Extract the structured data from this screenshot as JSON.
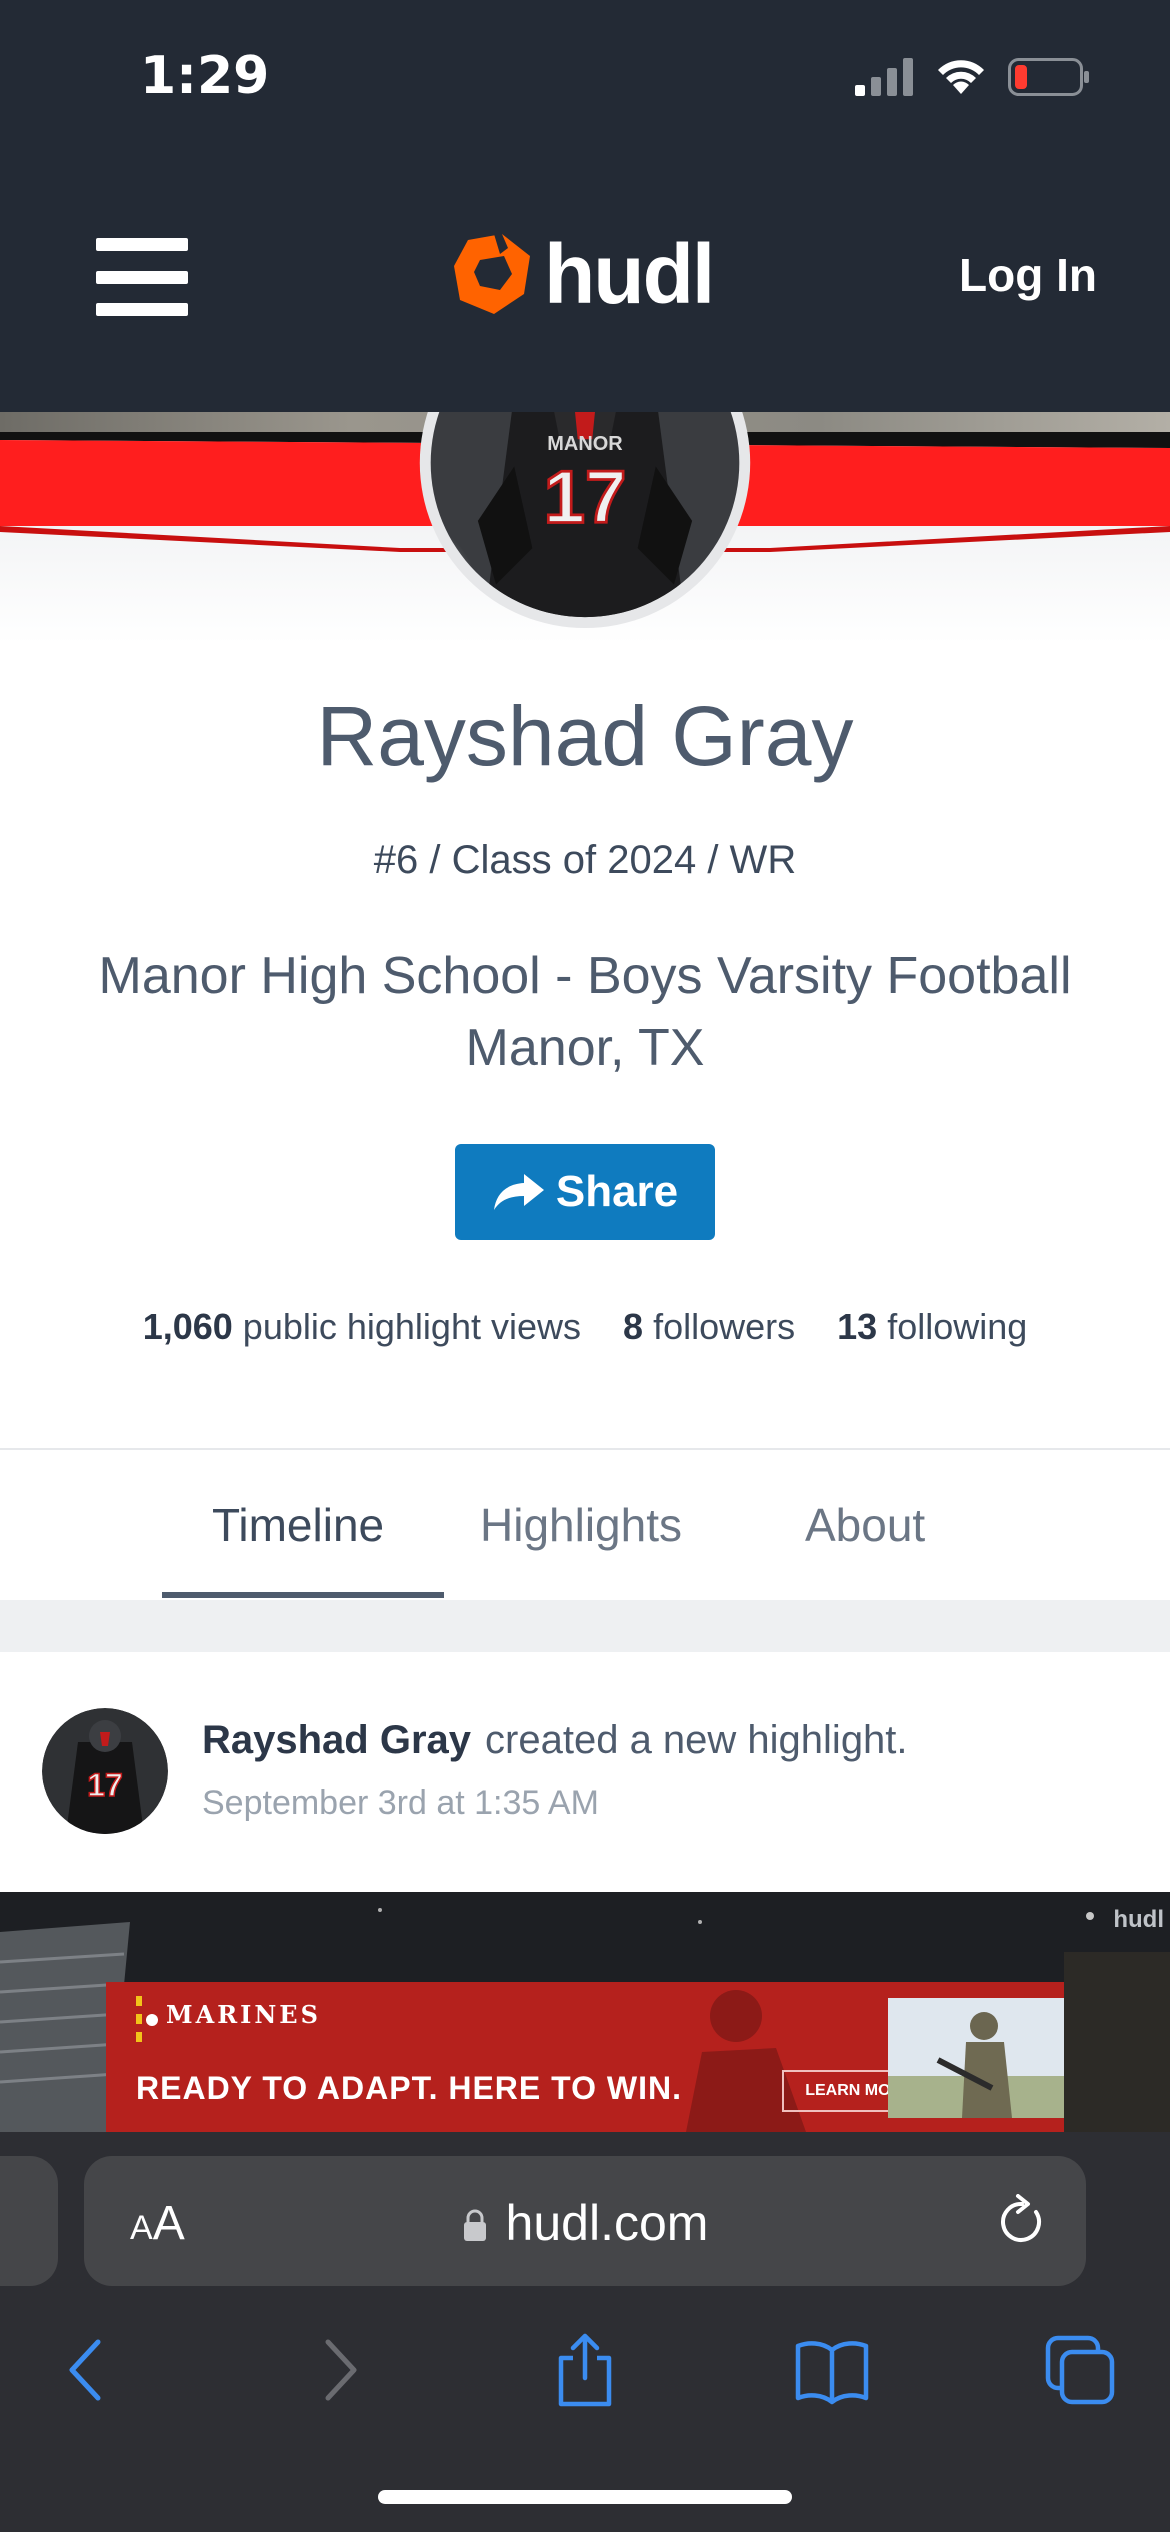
{
  "status_bar": {
    "time": "1:29"
  },
  "header": {
    "logo_text": "hudl",
    "login_label": "Log In"
  },
  "profile": {
    "name": "Rayshad Gray",
    "meta": "#6 / Class of 2024 / WR",
    "school": "Manor High School - Boys Varsity Football",
    "location": "Manor, TX",
    "share_label": "Share",
    "jersey_text": "MANOR",
    "jersey_number": "17",
    "stats": {
      "views_count": "1,060",
      "views_label": "public highlight views",
      "followers_count": "8",
      "followers_label": "followers",
      "following_count": "13",
      "following_label": "following"
    }
  },
  "tabs": [
    {
      "label": "Timeline",
      "active": true
    },
    {
      "label": "Highlights",
      "active": false
    },
    {
      "label": "About",
      "active": false
    }
  ],
  "feed": [
    {
      "author": "Rayshad Gray",
      "action": "created a new highlight.",
      "time": "September 3rd at 1:35 AM"
    }
  ],
  "video": {
    "watermark": "hudl"
  },
  "ad": {
    "brand": "MARINES",
    "headline": "READY TO ADAPT. HERE TO WIN.",
    "cta": "LEARN MORE"
  },
  "browser": {
    "text_size_large": "A",
    "text_size_small": "A",
    "url": "hudl.com"
  },
  "colors": {
    "header_bg": "#232a35",
    "brand_orange": "#ff6300",
    "share_blue": "#0f7bbf",
    "cover_red": "#ff1e1e",
    "ad_red": "#b5211d"
  },
  "icons": [
    "signal-icon",
    "wifi-icon",
    "battery-icon",
    "menu-icon",
    "hudl-logo-icon",
    "share-arrow-icon",
    "lock-icon",
    "reload-icon",
    "back-icon",
    "forward-icon",
    "share-sheet-icon",
    "bookmarks-icon",
    "tabs-icon"
  ]
}
